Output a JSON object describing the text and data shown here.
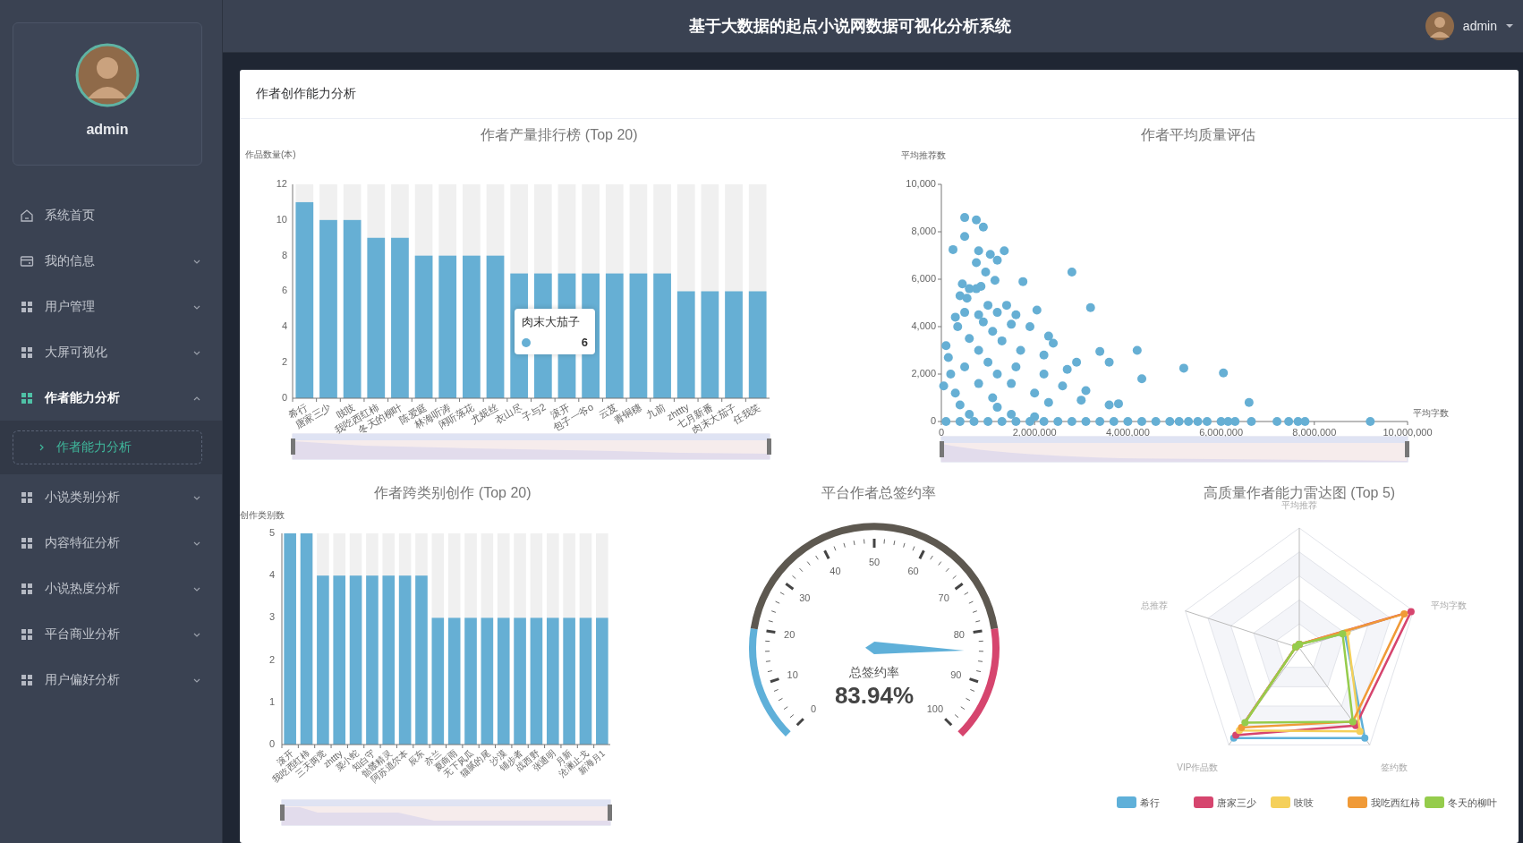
{
  "header": {
    "title": "基于大数据的起点小说网数据可视化分析系统",
    "user": "admin"
  },
  "sidebar": {
    "profile": {
      "name": "admin"
    },
    "menu": [
      {
        "label": "系统首页",
        "kind": "link",
        "selected": false
      },
      {
        "label": "我的信息",
        "kind": "group",
        "expanded": false,
        "selected": false
      },
      {
        "label": "用户管理",
        "kind": "group",
        "expanded": false,
        "selected": false
      },
      {
        "label": "大屏可视化",
        "kind": "group",
        "expanded": false,
        "selected": false
      },
      {
        "label": "作者能力分析",
        "kind": "group",
        "expanded": true,
        "selected": true,
        "children": [
          {
            "label": "作者能力分析",
            "selected": true
          }
        ]
      },
      {
        "label": "小说类别分析",
        "kind": "group",
        "expanded": false,
        "selected": false
      },
      {
        "label": "内容特征分析",
        "kind": "group",
        "expanded": false,
        "selected": false
      },
      {
        "label": "小说热度分析",
        "kind": "group",
        "expanded": false,
        "selected": false
      },
      {
        "label": "平台商业分析",
        "kind": "group",
        "expanded": false,
        "selected": false
      },
      {
        "label": "用户偏好分析",
        "kind": "group",
        "expanded": false,
        "selected": false
      }
    ]
  },
  "card": {
    "title": "作者创作能力分析"
  },
  "output_chart": {
    "chart_data": {
      "type": "bar",
      "title": "作者产量排行榜 (Top 20)",
      "ylabel": "作品数量(本)",
      "categories": [
        "希行",
        "唐家三少",
        "吱吱",
        "我吃西红柿",
        "冬天的柳叶",
        "陈爱庭",
        "林海听涛",
        "闲听落花",
        "尤妮丝",
        "衣山尽",
        "子与2",
        "滚开",
        "包子一爷o",
        "云芨",
        "青铜穗",
        "九前",
        "zhttty",
        "七月新番",
        "肉末大茄子",
        "任我笑"
      ],
      "series": [
        {
          "color": "#66afd4",
          "values": [
            11,
            10,
            10,
            9,
            9,
            8,
            8,
            8,
            8,
            7,
            7,
            7,
            7,
            7,
            7,
            7,
            6,
            6,
            6,
            6
          ]
        }
      ],
      "ylim": [
        0,
        12
      ],
      "yticks": [
        0,
        2,
        4,
        6,
        8,
        10,
        12
      ]
    },
    "tooltip": {
      "title": "肉末大茄子",
      "value": "6"
    }
  },
  "quality_chart": {
    "chart_data": {
      "type": "scatter",
      "title": "作者平均质量评估",
      "xlabel": "平均字数",
      "ylabel": "平均推荐数",
      "x": [
        500000,
        750000,
        900000,
        500000,
        250000,
        800000,
        1050000,
        1350000,
        750000,
        1200000,
        950000,
        2800000,
        1150000,
        1750000,
        450000,
        600000,
        750000,
        850000,
        400000,
        550000,
        500000,
        3200000,
        1000000,
        1400000,
        800000,
        1200000,
        1600000,
        2050000,
        300000,
        900000,
        1500000,
        1900000,
        350000,
        1100000,
        600000,
        2300000,
        2400000,
        1300000,
        100000,
        800000,
        1700000,
        3400000,
        4200000,
        150000,
        2200000,
        1000000,
        2900000,
        3600000,
        500000,
        1600000,
        2700000,
        5200000,
        6050000,
        200000,
        1200000,
        2200000,
        4300000,
        50000,
        800000,
        1500000,
        2600000,
        3100000,
        300000,
        1100000,
        2000000,
        3000000,
        2300000,
        3600000,
        3800000,
        6600000,
        400000,
        1200000,
        600000,
        1500000,
        2000000,
        100000,
        400000,
        700000,
        1000000,
        1300000,
        1600000,
        1900000,
        2200000,
        2500000,
        2800000,
        3100000,
        3400000,
        3700000,
        4000000,
        4300000,
        4600000,
        4900000,
        5100000,
        5300000,
        5500000,
        5700000,
        6000000,
        6150000,
        6300000,
        6650000,
        7200000,
        7450000,
        7650000,
        7800000,
        9200000
      ],
      "series": [
        {
          "color": "#66afd4",
          "values": [
            8600,
            8500,
            8200,
            7800,
            7250,
            7200,
            7050,
            7200,
            6700,
            6800,
            6300,
            6300,
            5950,
            5900,
            5800,
            5600,
            5600,
            5700,
            5300,
            5200,
            4600,
            4800,
            4900,
            4900,
            4500,
            4600,
            4500,
            4700,
            4400,
            4200,
            4100,
            4000,
            4000,
            3800,
            3500,
            3600,
            3300,
            3400,
            3200,
            3000,
            3000,
            2950,
            3000,
            2700,
            2800,
            2500,
            2500,
            2500,
            2300,
            2300,
            2200,
            2250,
            2050,
            2000,
            2000,
            2000,
            1800,
            1500,
            1600,
            1600,
            1500,
            1300,
            1200,
            1000,
            1200,
            900,
            800,
            700,
            750,
            800,
            700,
            600,
            300,
            300,
            200,
            0,
            0,
            0,
            0,
            0,
            0,
            0,
            0,
            0,
            0,
            0,
            0,
            0,
            0,
            0,
            0,
            0,
            0,
            0,
            0,
            0,
            0,
            0,
            0,
            0,
            0,
            0,
            0,
            0,
            0
          ]
        }
      ],
      "xlim": [
        0,
        10000000
      ],
      "ylim": [
        0,
        10000
      ],
      "xticks": [
        {
          "value": 0,
          "label": "0"
        },
        {
          "value": 2000000,
          "label": "2,000,000"
        },
        {
          "value": 4000000,
          "label": "4,000,000"
        },
        {
          "value": 6000000,
          "label": "6,000,000"
        },
        {
          "value": 8000000,
          "label": "8,000,000"
        },
        {
          "value": 10000000,
          "label": "10,000,000"
        }
      ],
      "yticks": [
        {
          "value": 0,
          "label": "0"
        },
        {
          "value": 2000,
          "label": "2,000"
        },
        {
          "value": 4000,
          "label": "4,000"
        },
        {
          "value": 6000,
          "label": "6,000"
        },
        {
          "value": 8000,
          "label": "8,000"
        },
        {
          "value": 10000,
          "label": "10,000"
        }
      ]
    }
  },
  "category_chart": {
    "chart_data": {
      "type": "bar",
      "title": "作者跨类别创作 (Top 20)",
      "ylabel": "创作类别数",
      "categories": [
        "滚开",
        "我吃西红柿",
        "三天两觉",
        "zhttty",
        "菜小蛇",
        "知白守",
        "骷髅精灵",
        "阿苏道尔本",
        "辰东",
        "亦兰",
        "夏商雨",
        "无下风瓜",
        "猫腻的尾",
        "沙漠",
        "铺步者",
        "战西野",
        "张通明",
        "月新",
        "沧澜止戈",
        "新海月1"
      ],
      "series": [
        {
          "color": "#66afd4",
          "values": [
            5,
            5,
            4,
            4,
            4,
            4,
            4,
            4,
            4,
            3,
            3,
            3,
            3,
            3,
            3,
            3,
            3,
            3,
            3,
            3
          ]
        }
      ],
      "ylim": [
        0,
        5
      ],
      "yticks": [
        0,
        1,
        2,
        3,
        4,
        5
      ]
    }
  },
  "gauge": {
    "title": "平台作者总签约率",
    "label": "总签约率",
    "reading": "83.94%",
    "level": 0.8394,
    "ticks": [
      "0",
      "10",
      "20",
      "30",
      "40",
      "50",
      "60",
      "70",
      "80",
      "90",
      "100"
    ]
  },
  "radar": {
    "title": "高质量作者能力雷达图 (Top 5)",
    "indicators": [
      "平均推荐",
      "平均字数",
      "签约数",
      "VIP作品数",
      "总推荐"
    ],
    "legend": [
      {
        "name": "希行",
        "color": "#5fb0d9"
      },
      {
        "name": "唐家三少",
        "color": "#d6456e"
      },
      {
        "name": "吱吱",
        "color": "#f5d05a"
      },
      {
        "name": "我吃西红柿",
        "color": "#f09a37"
      },
      {
        "name": "冬天的柳叶",
        "color": "#95cc4c"
      }
    ]
  }
}
